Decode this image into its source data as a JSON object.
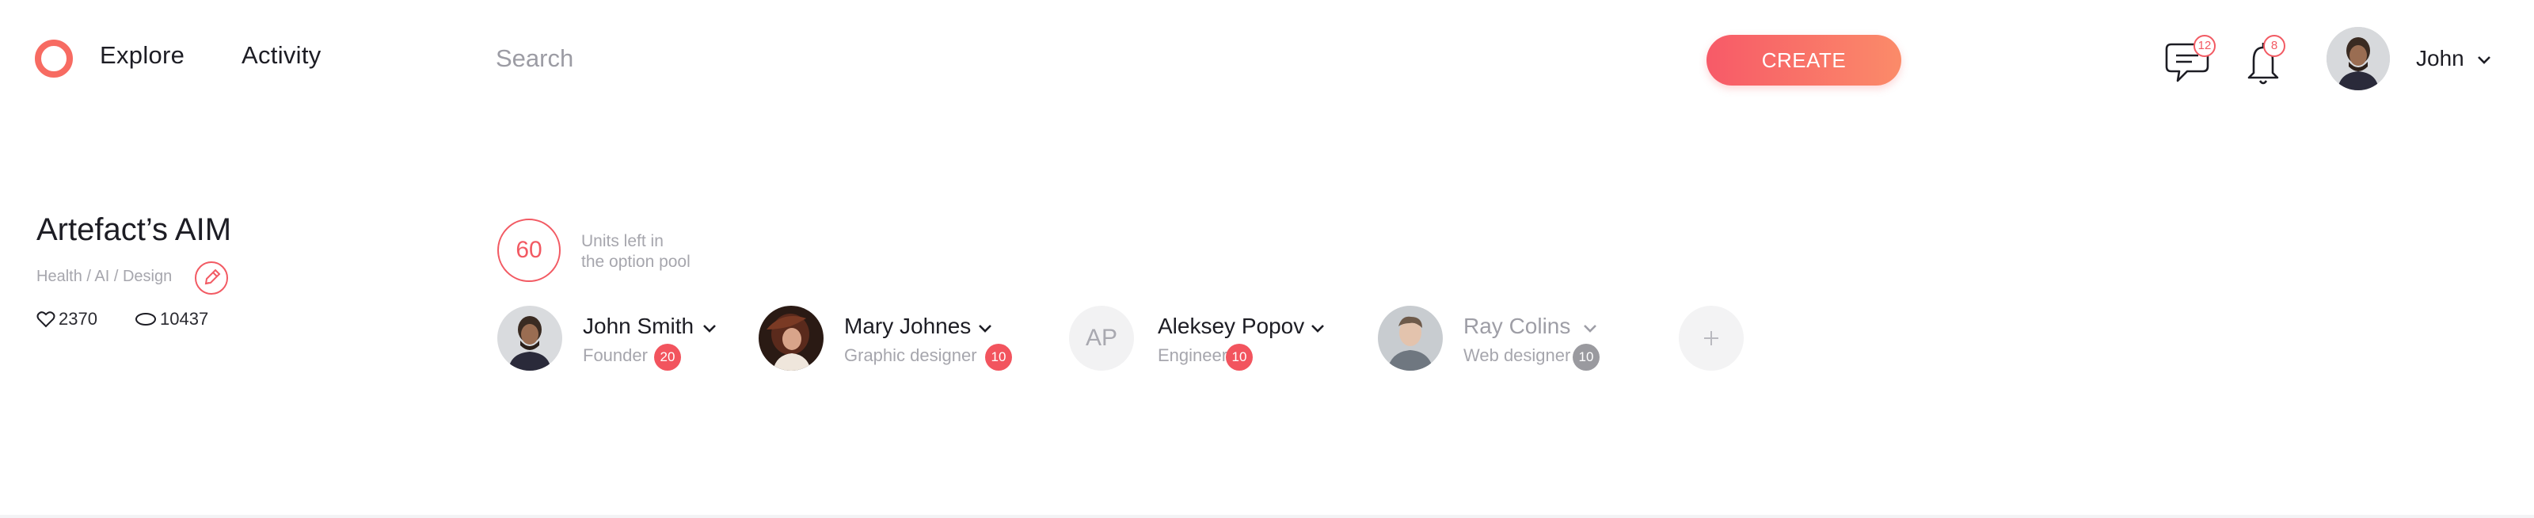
{
  "header": {
    "nav": [
      "Explore",
      "Activity"
    ],
    "search_placeholder": "Search",
    "create_label": "CREATE",
    "messages_count": "12",
    "notifications_count": "8",
    "user_name": "John",
    "icons": {
      "logo": "ring-logo-icon",
      "messages": "chat-bubble-icon",
      "notifications": "bell-icon",
      "user_menu": "chevron-down-icon"
    }
  },
  "project": {
    "title": "Artefact’s AIM",
    "tags": "Health / AI / Design",
    "likes": "2370",
    "views": "10437",
    "icons": {
      "edit": "pencil-icon",
      "likes": "heart-icon",
      "views": "eye-icon"
    }
  },
  "pool": {
    "units": "60",
    "line1": "Units left in",
    "line2": "the option pool"
  },
  "members": [
    {
      "name": "John Smith",
      "role": "Founder",
      "units": "20",
      "initials": ""
    },
    {
      "name": "Mary Johnes",
      "role": "Graphic designer",
      "units": "10",
      "initials": ""
    },
    {
      "name": "Aleksey Popov",
      "role": "Engineer",
      "units": "10",
      "initials": "AP"
    },
    {
      "name": "Ray Colins",
      "role": "Web designer",
      "units": "10",
      "initials": ""
    }
  ],
  "colors": {
    "accent": "#f25a63",
    "gradient_start": "#f75a68",
    "gradient_end": "#fb8b69",
    "muted_text": "#a6a6ad",
    "muted_badge": "#9a9a9f"
  }
}
